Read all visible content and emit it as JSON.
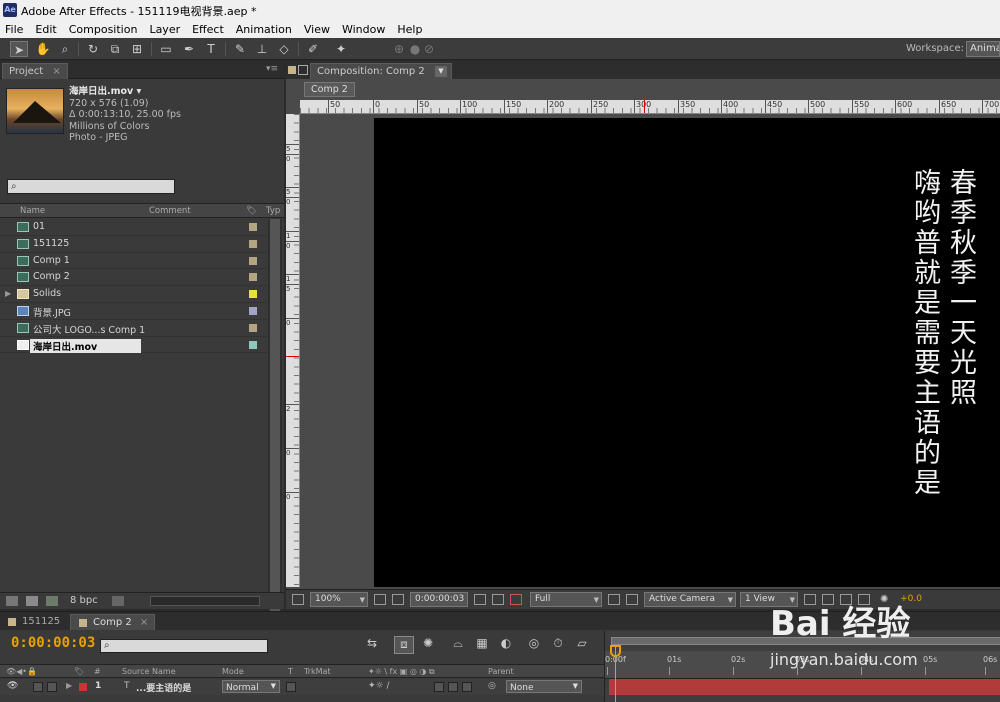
{
  "window": {
    "title": "Adobe After Effects - 151119电视背景.aep *",
    "app_icon": "Ae"
  },
  "menu": [
    "File",
    "Edit",
    "Composition",
    "Layer",
    "Effect",
    "Animation",
    "View",
    "Window",
    "Help"
  ],
  "toolbar": {
    "tools": [
      "selection-tool",
      "hand-tool",
      "zoom-tool",
      "rotate-tool",
      "camera-tool",
      "pan-behind-tool",
      "rectangle-tool",
      "pen-tool",
      "type-tool",
      "brush-tool",
      "clone-stamp-tool",
      "eraser-tool",
      "roto-brush-tool",
      "puppet-pin-tool"
    ],
    "workspace_label": "Workspace:",
    "workspace_value": "Animation"
  },
  "project": {
    "tab": "Project",
    "footage": {
      "name": "海岸日出.mov ▾",
      "size": "720 x 576 (1.09)",
      "duration": "Δ 0:00:13:10, 25.00 fps",
      "colors": "Millions of Colors",
      "codec": "Photo - JPEG"
    },
    "columns": {
      "name": "Name",
      "comment": "Comment",
      "type": "Typ"
    },
    "items": [
      {
        "name": "01",
        "kind": "comp",
        "color": "#b4a582"
      },
      {
        "name": "151125",
        "kind": "comp",
        "color": "#b4a582"
      },
      {
        "name": "Comp 1",
        "kind": "comp",
        "color": "#b4a582"
      },
      {
        "name": "Comp 2",
        "kind": "comp",
        "color": "#b4a582"
      },
      {
        "name": "Solids",
        "kind": "folder",
        "color": "#e8e03c"
      },
      {
        "name": "背景.JPG",
        "kind": "image",
        "color": "#a3a3c8"
      },
      {
        "name": "公司大 LOGO...s Comp 1",
        "kind": "comp",
        "color": "#b4a582"
      },
      {
        "name": "海岸日出.mov",
        "kind": "movie",
        "color": "#8fc7bd",
        "selected": true
      }
    ],
    "bpc": "8 bpc"
  },
  "composition": {
    "tab": "Composition: Comp 2",
    "crumb": "Comp 2",
    "ruler_top": [
      "50",
      "0",
      "50",
      "100",
      "150",
      "200",
      "250",
      "300",
      "350",
      "400",
      "450",
      "500",
      "550",
      "600",
      "650",
      "700"
    ],
    "ruler_left": [
      "5",
      "0",
      "5",
      "0",
      "1",
      "0",
      "1",
      "5",
      "0",
      "2",
      "0",
      "0"
    ],
    "text_col_right": "春季秋季一天光照",
    "text_col_left": "嗨哟普就是需要主语的是",
    "footer": {
      "zoom": "100%",
      "timecode": "0:00:00:03",
      "resolution": "Full",
      "camera": "Active Camera",
      "views": "1 View",
      "exposure": "+0.0"
    }
  },
  "timeline": {
    "tabs": [
      "151125",
      "Comp 2"
    ],
    "timecode": "0:00:00:03",
    "columns": {
      "num": "#",
      "source": "Source Name",
      "mode": "Mode",
      "t": "T",
      "trkmat": "TrkMat",
      "parent": "Parent"
    },
    "layer": {
      "num": "1",
      "name": "...要主语的是",
      "mode": "Normal",
      "parent": "None"
    },
    "time_ticks": [
      "0:00f",
      "01s",
      "02s",
      "03s",
      "04s",
      "05s",
      "06s"
    ]
  },
  "watermark": {
    "logo": "Bai 经验",
    "sub": "jingyan.baidu.com"
  },
  "colors": {
    "accent": "#e8a100",
    "layer_bar": "#b23a3a",
    "canvas": "#000000"
  }
}
